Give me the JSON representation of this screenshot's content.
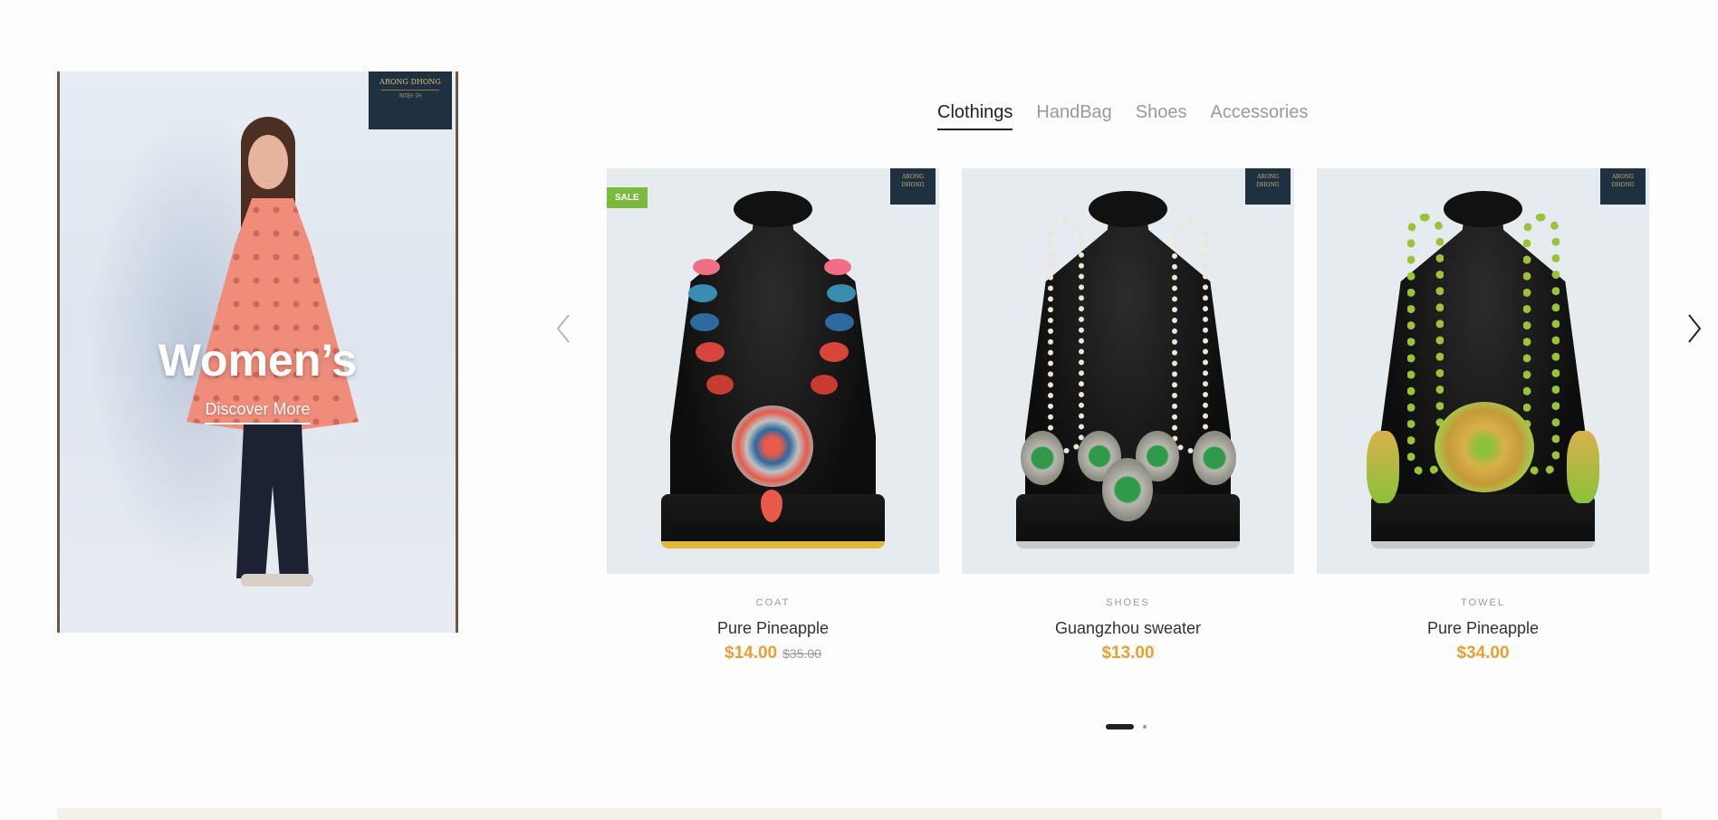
{
  "banner": {
    "brand_tag_top": "ARONG DHONG",
    "brand_tag_bottom": "আড়ং ঢং",
    "title": "Women’s",
    "cta": "Discover More"
  },
  "tabs": [
    {
      "label": "Clothings",
      "active": true
    },
    {
      "label": "HandBag",
      "active": false
    },
    {
      "label": "Shoes",
      "active": false
    },
    {
      "label": "Accessories",
      "active": false
    }
  ],
  "products": [
    {
      "badge": "SALE",
      "category": "COAT",
      "name": "Pure Pineapple",
      "price": "$14.00",
      "old_price": "$35.00",
      "necklace_color": "multicolor"
    },
    {
      "badge": "",
      "category": "SHOES",
      "name": "Guangzhou sweater",
      "price": "$13.00",
      "old_price": "",
      "necklace_color": "pearl-green"
    },
    {
      "badge": "",
      "category": "TOWEL",
      "name": "Pure Pineapple",
      "price": "$34.00",
      "old_price": "",
      "necklace_color": "lime-green"
    }
  ],
  "carousel": {
    "prev_icon": "chevron-left-icon",
    "next_icon": "chevron-right-icon",
    "pages": 2,
    "active_page": 1
  },
  "colors": {
    "accent_price": "#e8a033",
    "sale_badge": "#7abb3f",
    "tab_active": "#222222",
    "tab_inactive": "#9a9a9a"
  }
}
